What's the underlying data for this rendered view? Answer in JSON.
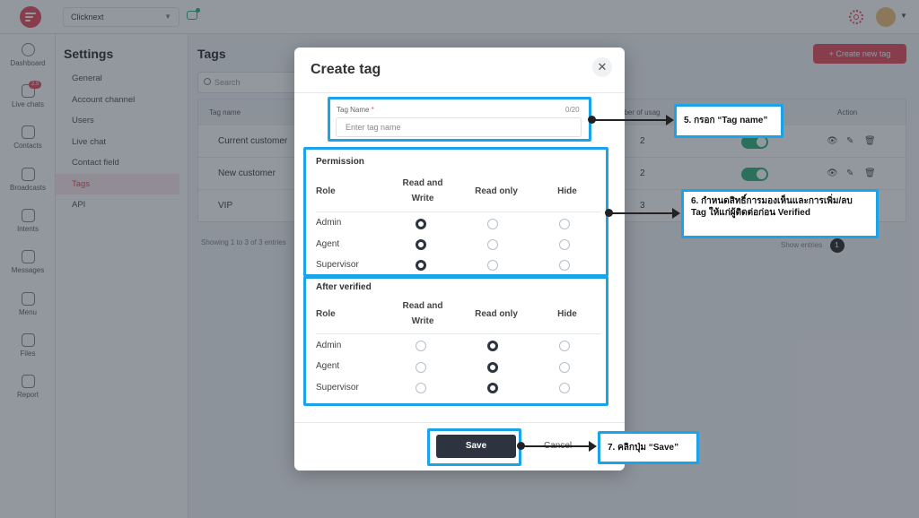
{
  "topbar": {
    "workspace": "Clicknext",
    "workspace_chevron": "chevron-down-icon"
  },
  "rail": {
    "items": [
      {
        "label": "Dashboard",
        "icon": "dashboard-icon"
      },
      {
        "label": "Live chats",
        "icon": "live-chat-icon",
        "badge": "2.5"
      },
      {
        "label": "Contacts",
        "icon": "contacts-icon"
      },
      {
        "label": "Broadcasts",
        "icon": "broadcast-icon"
      },
      {
        "label": "Intents",
        "icon": "intents-icon"
      },
      {
        "label": "Messages",
        "icon": "messages-icon"
      },
      {
        "label": "Menu",
        "icon": "menu-icon"
      },
      {
        "label": "Files",
        "icon": "folder-icon"
      },
      {
        "label": "Report",
        "icon": "report-icon"
      }
    ]
  },
  "settings": {
    "title": "Settings",
    "items": [
      {
        "label": "General"
      },
      {
        "label": "Account channel"
      },
      {
        "label": "Users"
      },
      {
        "label": "Live chat"
      },
      {
        "label": "Contact field"
      },
      {
        "label": "Tags",
        "active": true
      },
      {
        "label": "API"
      }
    ]
  },
  "main": {
    "title": "Tags",
    "create_button": "+ Create new tag",
    "search_placeholder": "Search",
    "columns": {
      "name": "Tag name",
      "usage": "nber of usag",
      "action": "Action"
    },
    "rows": [
      {
        "name": "Current customer",
        "usage": "2"
      },
      {
        "name": "New customer",
        "usage": "2"
      },
      {
        "name": "VIP",
        "usage": "3"
      }
    ],
    "footer": "Showing 1 to 3 of 3 entries",
    "pager_show": "Show",
    "pager_entries": "entries",
    "pager_page": "1"
  },
  "modal": {
    "title": "Create tag",
    "close_icon": "close-icon",
    "tag_name_label": "Tag Name",
    "tag_name_required": "*",
    "tag_name_count": "0/20",
    "tag_name_placeholder": "Enter tag name",
    "permission": {
      "title": "Permission",
      "headers": [
        "Role",
        "Read and Write",
        "Read only",
        "Hide"
      ],
      "rows": [
        {
          "role": "Admin",
          "selected": "Read and Write"
        },
        {
          "role": "Agent",
          "selected": "Read and Write"
        },
        {
          "role": "Supervisor",
          "selected": "Read and Write"
        }
      ]
    },
    "after_verified": {
      "title": "After verified",
      "headers": [
        "Role",
        "Read and Write",
        "Read only",
        "Hide"
      ],
      "rows": [
        {
          "role": "Admin",
          "selected": "Read only"
        },
        {
          "role": "Agent",
          "selected": "Read only"
        },
        {
          "role": "Supervisor",
          "selected": "Read only"
        }
      ]
    },
    "save": "Save",
    "cancel": "Cancel"
  },
  "annotations": {
    "step5": "5. กรอก “Tag name”",
    "step6_line1": "6. กำหนดสิทธิ์การมองเห็นและการเพิ่ม/ลบ",
    "step6_line2": "Tag ให้แก่ผู้ติดต่อก่อน Verified",
    "step7": "7. คลิกปุ่ม “Save”",
    "highlight_color": "#1aa3e8"
  },
  "colors": {
    "brand": "#e8515e",
    "primary_dark": "#2d3440",
    "toggle_on": "#36b37e"
  }
}
